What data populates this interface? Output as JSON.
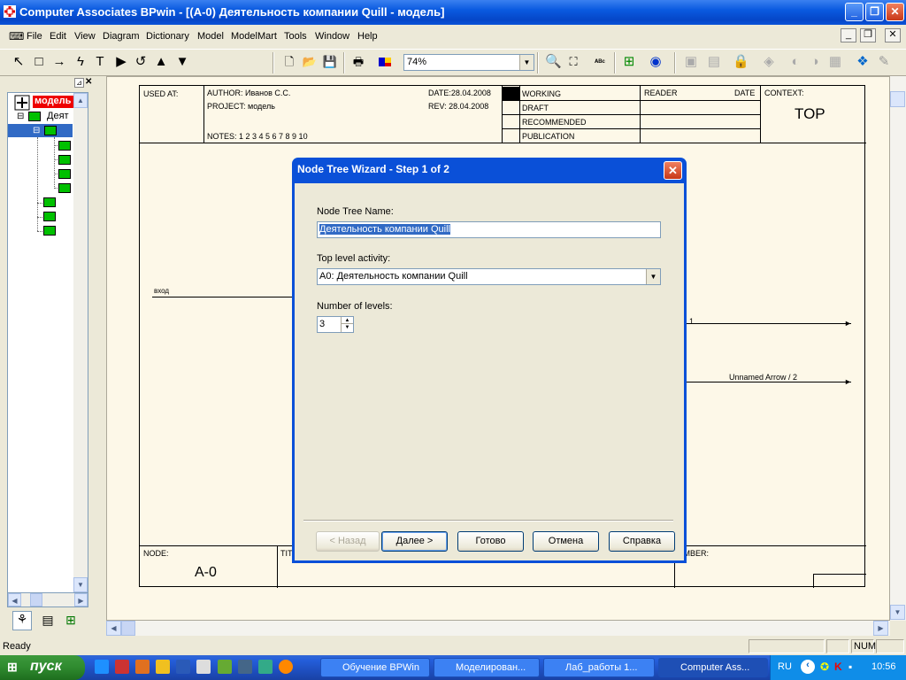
{
  "window": {
    "title": "Computer Associates BPwin - [(A-0) Деятельность компании Quill - модель]"
  },
  "menu": [
    "File",
    "Edit",
    "View",
    "Diagram",
    "Dictionary",
    "Model",
    "ModelMart",
    "Tools",
    "Window",
    "Help"
  ],
  "toolbar": {
    "zoom_value": "74%"
  },
  "tree": {
    "root_label": "модель",
    "child_label": "Деят"
  },
  "diagram": {
    "used_at": "USED AT:",
    "author": "AUTHOR: Иванов С.С.",
    "project": "PROJECT: модель",
    "date": "DATE:28.04.2008",
    "rev": "REV: 28.04.2008",
    "notes": "NOTES: 1 2 3 4 5 6 7 8 9 10",
    "working": "WORKING",
    "draft": "DRAFT",
    "recommended": "RECOMMENDED",
    "publication": "PUBLICATION",
    "reader": "READER",
    "date_col": "DATE",
    "context": "CONTEXT:",
    "context_value": "TOP",
    "node_label": "NODE:",
    "node_value": "A-0",
    "title_label": "TIT",
    "number_label": "UMBER:",
    "arrow_in": "вход",
    "arrow_out1": "1",
    "arrow_out2": "Unnamed Arrow / 2"
  },
  "dialog": {
    "title": "Node Tree Wizard - Step 1 of 2",
    "name_label": "Node Tree Name:",
    "name_value": "Деятельность компании Quill",
    "top_label": "Top level activity:",
    "top_value": "A0:  Деятельность компании Quill",
    "levels_label": "Number of levels:",
    "levels_value": "3",
    "btn_back": "< Назад",
    "btn_next": "Далее >",
    "btn_finish": "Готово",
    "btn_cancel": "Отмена",
    "btn_help": "Справка"
  },
  "status": {
    "text": "Ready",
    "num": "NUM"
  },
  "taskbar": {
    "start": "пуск",
    "tasks": [
      "Обучение BPWin",
      "Моделирован...",
      "Лаб_работы 1...",
      "Computer Ass..."
    ],
    "lang": "RU",
    "clock": "10:56"
  }
}
